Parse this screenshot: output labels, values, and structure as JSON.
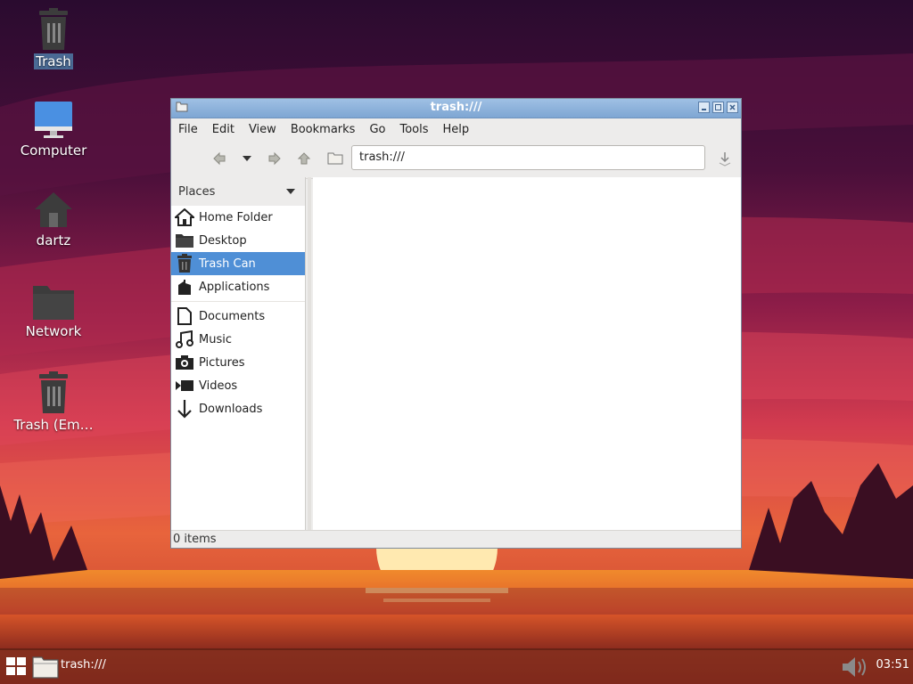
{
  "desktop": {
    "icons": [
      {
        "label": "Trash",
        "icon": "trash-icon"
      },
      {
        "label": "Computer",
        "icon": "monitor-icon"
      },
      {
        "label": "dartz",
        "icon": "home-icon"
      },
      {
        "label": "Network",
        "icon": "folder-icon"
      },
      {
        "label": "Trash (Em…",
        "icon": "trash-icon"
      }
    ]
  },
  "window": {
    "title": "trash:///",
    "menu": [
      "File",
      "Edit",
      "View",
      "Bookmarks",
      "Go",
      "Tools",
      "Help"
    ],
    "address": "trash:///",
    "sidebar": {
      "header": "Places",
      "group1": [
        {
          "label": "Home Folder",
          "icon": "home-icon"
        },
        {
          "label": "Desktop",
          "icon": "folder-icon"
        },
        {
          "label": "Trash Can",
          "icon": "trash-icon",
          "active": true
        },
        {
          "label": "Applications",
          "icon": "applications-icon"
        }
      ],
      "group2": [
        {
          "label": "Documents",
          "icon": "document-icon"
        },
        {
          "label": "Music",
          "icon": "music-icon"
        },
        {
          "label": "Pictures",
          "icon": "camera-icon"
        },
        {
          "label": "Videos",
          "icon": "video-icon"
        },
        {
          "label": "Downloads",
          "icon": "download-icon"
        }
      ]
    },
    "status": "0 items"
  },
  "taskbar": {
    "task_label": "trash:///",
    "clock": "03:51"
  },
  "colors": {
    "selection": "#4f8fd6",
    "titlebar": "#8db3dd"
  }
}
